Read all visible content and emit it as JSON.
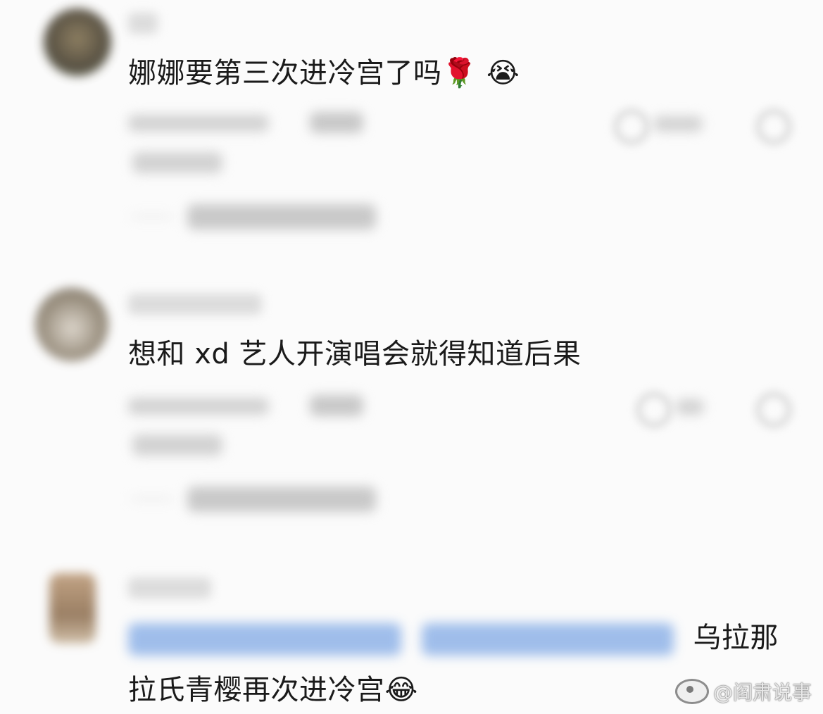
{
  "comments": [
    {
      "text": "娜娜要第三次进冷宫了吗",
      "emojis": [
        "🌹",
        "😭"
      ],
      "avatar_color": "#4f3e2b"
    },
    {
      "text": "想和 xd 艺人开演唱会就得知道后果",
      "avatar_color": "#8a7e6b"
    },
    {
      "text_after_mention": "乌拉那",
      "text_line2": "拉氏青樱再次进冷宫",
      "emojis": [
        "😂"
      ],
      "avatar_color": "#a08060"
    }
  ],
  "watermark": {
    "text": "@阎肃说事",
    "icon": "weibo-logo-icon"
  },
  "colors": {
    "background": "#fbfbfb",
    "mention_blue": "#8fb3e8",
    "text": "#1a1a1a"
  }
}
